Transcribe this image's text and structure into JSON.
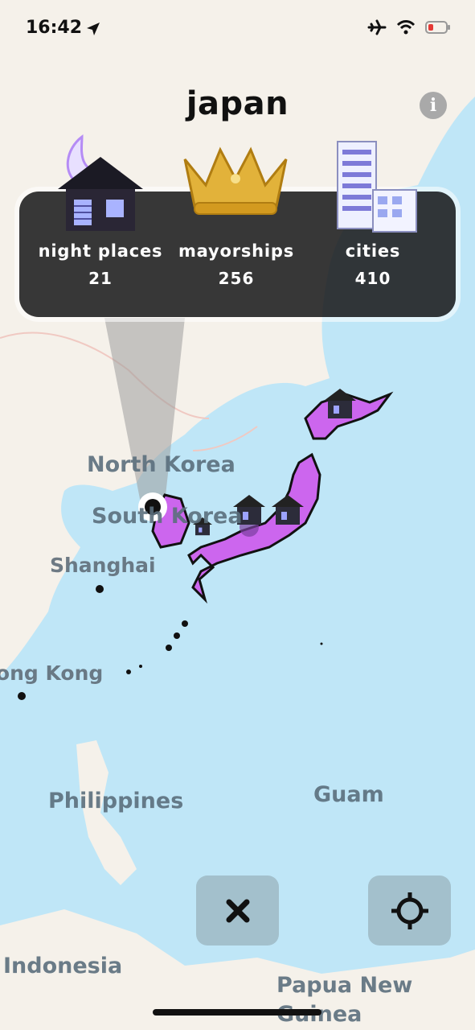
{
  "status_bar": {
    "time": "16:42",
    "icons": [
      "location-arrow-icon",
      "airplane-icon",
      "wifi-icon",
      "battery-low-icon"
    ],
    "battery_color": "#e53935"
  },
  "header": {
    "title": "japan",
    "info_icon": "info-icon",
    "info_glyph": "i"
  },
  "stats": [
    {
      "label": "night places",
      "value": "21",
      "icon": "night-house-icon"
    },
    {
      "label": "mayorships",
      "value": "256",
      "icon": "crown-icon"
    },
    {
      "label": "cities",
      "value": "410",
      "icon": "city-buildings-icon"
    }
  ],
  "map": {
    "labels": [
      "North Korea",
      "South Korea",
      "Shanghai",
      "Hong Kong",
      "Philippines",
      "Guam",
      "Indonesia",
      "Papua New Guinea"
    ],
    "highlight_color": "#cc66ee",
    "sea_color": "#bfe6f7",
    "land_color": "#f5f1ea"
  },
  "controls": {
    "close_icon": "close-icon",
    "locate_icon": "crosshair-icon"
  }
}
